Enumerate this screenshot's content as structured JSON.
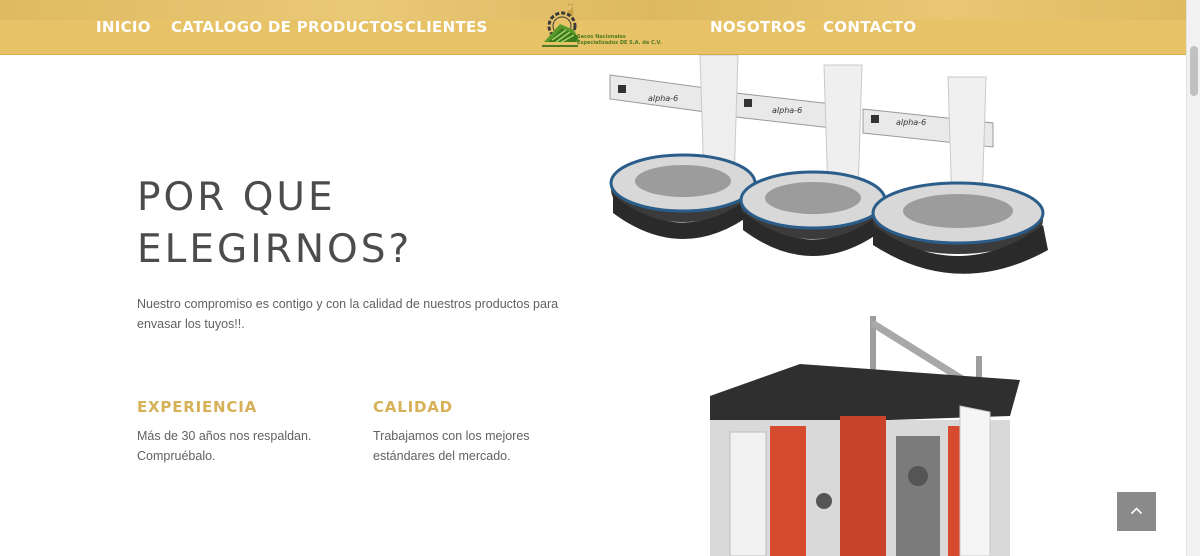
{
  "nav": {
    "left": [
      {
        "label": "INICIO"
      },
      {
        "label": "CATALOGO DE PRODUCTOS"
      },
      {
        "label": "CLIENTES"
      }
    ],
    "right": [
      {
        "label": "NOSOTROS"
      },
      {
        "label": "CONTACTO"
      }
    ],
    "logo": {
      "line1": "Sacos Nacionales",
      "line2": "Especializados DE S.A. de C.V."
    }
  },
  "hero": {
    "headline_line1": "POR QUE",
    "headline_line2": "ELEGIRNOS?",
    "intro": "Nuestro compromiso es contigo y con la calidad de nuestros productos para envasar los tuyos!!."
  },
  "features": [
    {
      "title": "EXPERIENCIA",
      "text": "Más de 30 años nos respaldan. Compruébalo."
    },
    {
      "title": "CALIDAD",
      "text": "Trabajamos con los mejores estándares del mercado."
    }
  ],
  "machines": {
    "brand_label": "alpha-6"
  },
  "icons": {
    "back_to_top": "chevron-up-icon"
  },
  "colors": {
    "nav_bg": "#e7c267",
    "accent": "#d6b157",
    "headline": "#4c4c4c",
    "body_text": "#616161",
    "logo_green": "#4e7a23",
    "back_to_top_bg": "#8a8a8a"
  }
}
